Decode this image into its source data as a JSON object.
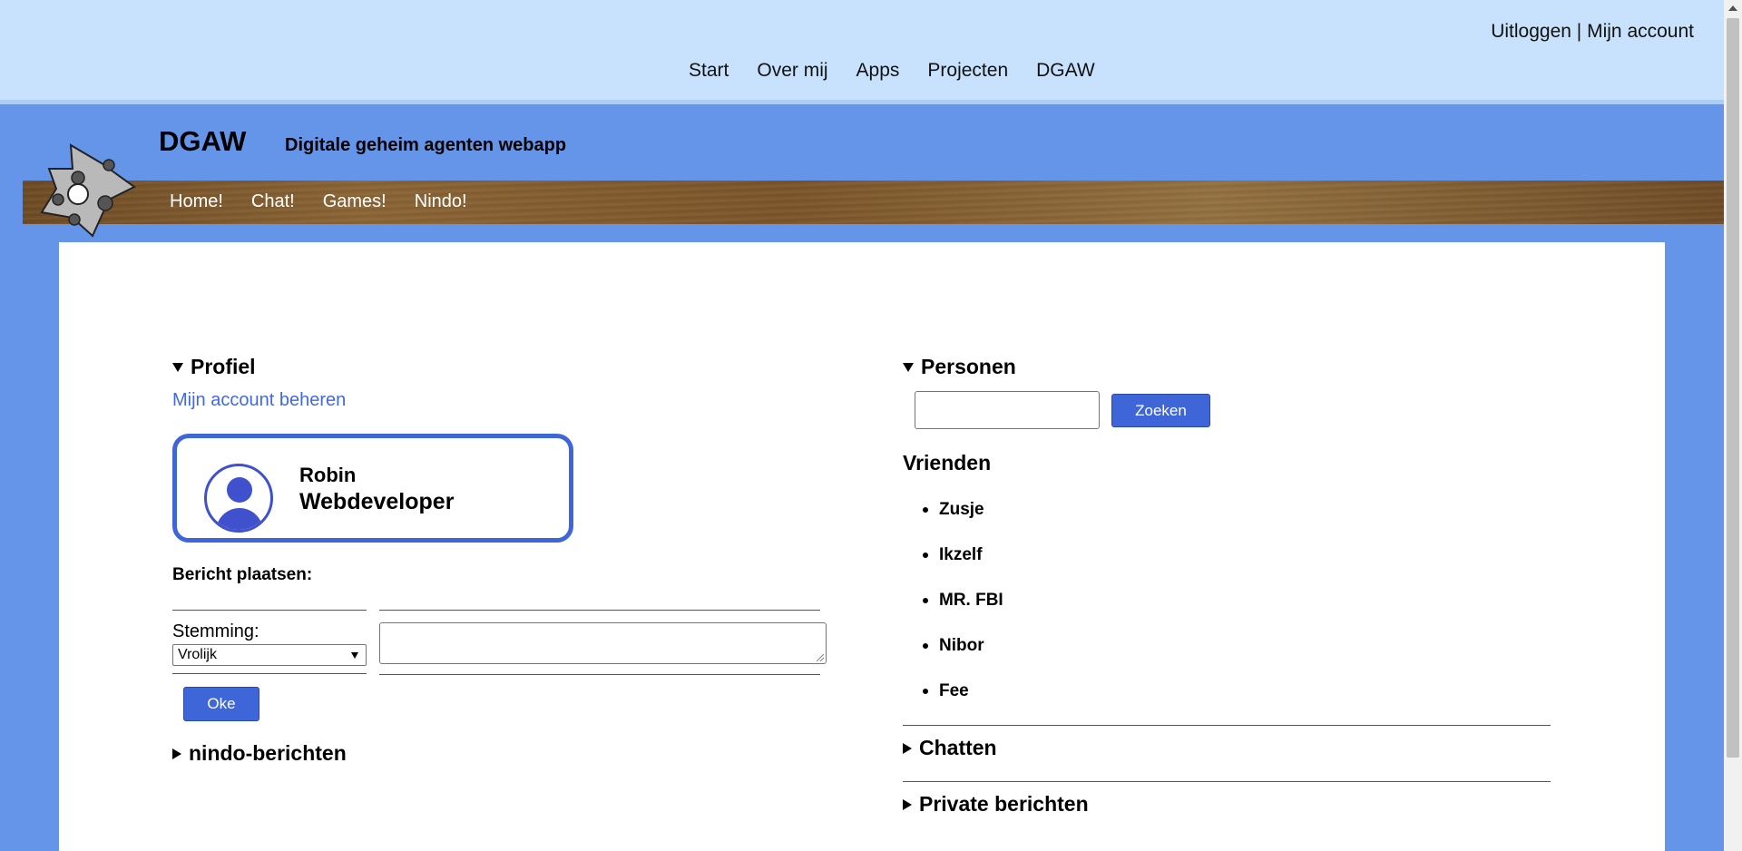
{
  "topbar": {
    "account": {
      "logout": "Uitloggen",
      "separator": "|",
      "my_account": "Mijn account"
    },
    "nav": [
      "Start",
      "Over mij",
      "Apps",
      "Projecten",
      "DGAW"
    ]
  },
  "brand": {
    "title": "DGAW",
    "subtitle": "Digitale geheim agenten webapp"
  },
  "woodnav": [
    "Home!",
    "Chat!",
    "Games!",
    "Nindo!"
  ],
  "profile": {
    "summary": "Profiel",
    "manage_link": "Mijn account beheren",
    "card": {
      "name": "Robin",
      "role": "Webdeveloper"
    },
    "post_label": "Bericht plaatsen:",
    "mood_label": "Stemming:",
    "mood_value": "Vrolijk",
    "submit": "Oke",
    "nindo_summary": "nindo-berichten"
  },
  "people": {
    "summary": "Personen",
    "search_button": "Zoeken",
    "friends_title": "Vrienden",
    "friends": [
      "Zusje",
      "Ikzelf",
      "MR. FBI",
      "Nibor",
      "Fee"
    ],
    "chat_summary": "Chatten",
    "private_summary": "Private berichten"
  },
  "colors": {
    "page_bg": "#6495e8",
    "topbar_bg": "#c8e2fd",
    "accent": "#3f66d8",
    "link": "#4169e1"
  }
}
